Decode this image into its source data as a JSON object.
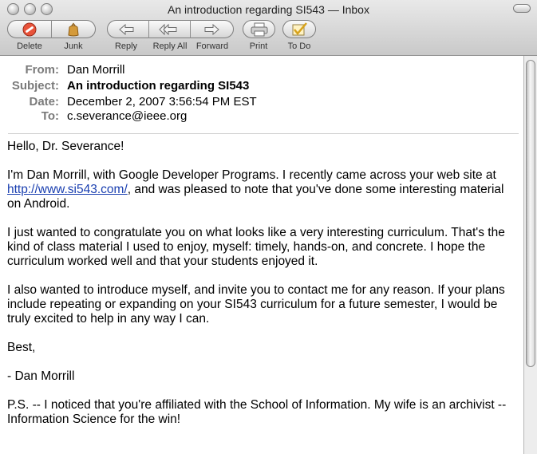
{
  "window": {
    "title": "An introduction regarding SI543 — Inbox"
  },
  "toolbar": {
    "delete_label": "Delete",
    "junk_label": "Junk",
    "reply_label": "Reply",
    "reply_all_label": "Reply All",
    "forward_label": "Forward",
    "print_label": "Print",
    "todo_label": "To Do"
  },
  "icons": {
    "delete": "no-entry-icon",
    "junk": "trash-bag-icon",
    "reply": "reply-arrow-icon",
    "reply_all": "reply-all-arrow-icon",
    "forward": "forward-arrow-icon",
    "print": "printer-icon",
    "todo": "checkmark-icon"
  },
  "headers": {
    "from_label": "From:",
    "from_value": "Dan Morrill",
    "subject_label": "Subject:",
    "subject_value": "An introduction regarding SI543",
    "date_label": "Date:",
    "date_value": "December 2, 2007 3:56:54 PM EST",
    "to_label": "To:",
    "to_value": "c.severance@ieee.org"
  },
  "message": {
    "greeting": "Hello, Dr. Severance!",
    "p1_before": "I'm Dan Morrill, with Google Developer Programs.  I recently came across your web site at ",
    "p1_link": "http://www.si543.com/",
    "p1_after": ", and was pleased to note that you've done some interesting material on Android.",
    "p2": "I just wanted to congratulate you on what looks like a very interesting curriculum.  That's the kind of class material I used to enjoy, myself: timely, hands-on, and concrete.  I hope the curriculum worked well and that your students enjoyed it.",
    "p3": "I also wanted to introduce myself, and invite you to contact me for any reason.  If your plans include repeating or expanding on your SI543 curriculum for a future semester, I would be truly excited to help in any way I can.",
    "closing": "Best,",
    "signature": "- Dan Morrill",
    "ps": "P.S. -- I noticed that you're affiliated with the School of Information.  My wife is an archivist -- Information Science for the win!"
  },
  "colors": {
    "link": "#1a3fb0",
    "header_label": "#7a7a7a"
  }
}
